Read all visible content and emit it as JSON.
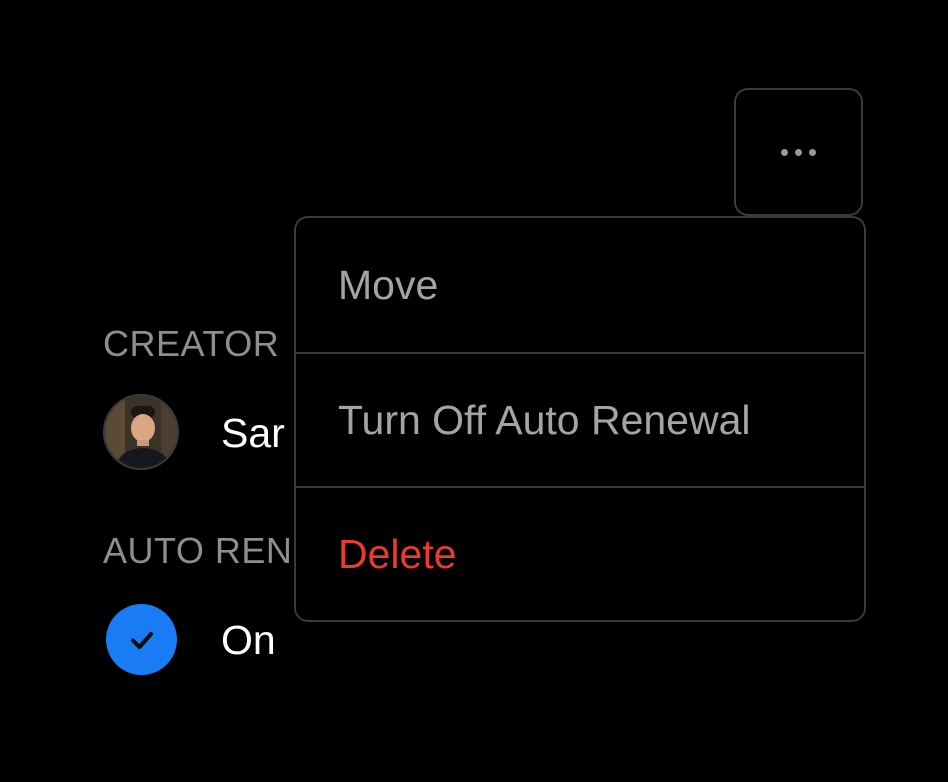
{
  "more_button": {
    "icon": "more-horizontal-icon"
  },
  "details": {
    "creator_label": "CREATOR",
    "creator_name": "Sar",
    "auto_renewal_label": "AUTO REN",
    "auto_renewal_value": "On"
  },
  "menu": {
    "items": [
      {
        "label": "Move"
      },
      {
        "label": "Turn Off Auto Renewal"
      },
      {
        "label": "Delete"
      }
    ]
  },
  "colors": {
    "background": "#000000",
    "border": "#3a3a3c",
    "menu_text": "#a4a4a8",
    "danger": "#ea3b2e",
    "accent": "#1a7cf5"
  }
}
